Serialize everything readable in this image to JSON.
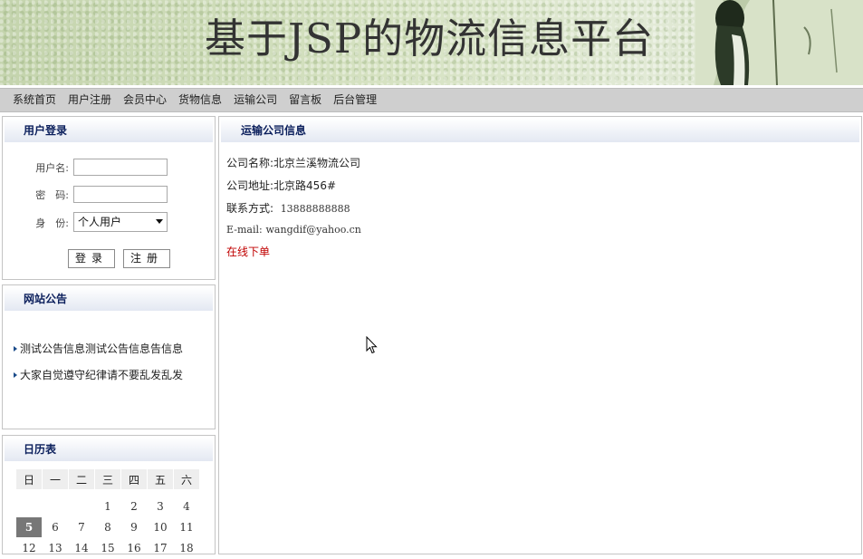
{
  "banner": {
    "title": "基于JSP的物流信息平台"
  },
  "nav": {
    "items": [
      "系统首页",
      "用户注册",
      "会员中心",
      "货物信息",
      "运输公司",
      "留言板",
      "后台管理"
    ]
  },
  "login": {
    "title": "用户登录",
    "username_label": "用户名:",
    "password_label": "密　码:",
    "role_label": "身　份:",
    "role_value": "个人用户",
    "login_button": "登录",
    "register_button": "注册"
  },
  "notice": {
    "title": "网站公告",
    "items": [
      "测试公告信息测试公告信息告信息",
      "大家自觉遵守纪律请不要乱发乱发"
    ]
  },
  "calendar": {
    "title": "日历表",
    "weekdays": [
      "日",
      "一",
      "二",
      "三",
      "四",
      "五",
      "六"
    ],
    "week1": [
      "",
      "",
      "",
      "1",
      "2",
      "3",
      "4"
    ],
    "week2": [
      "5",
      "6",
      "7",
      "8",
      "9",
      "10",
      "11"
    ],
    "week3": [
      "12",
      "13",
      "14",
      "15",
      "16",
      "17",
      "18"
    ],
    "today": "5"
  },
  "company": {
    "title": "运输公司信息",
    "name_label": "公司名称:",
    "name_value": "北京兰溪物流公司",
    "address_label": "公司地址:",
    "address_value": "北京路456#",
    "contact_label": "联系方式:",
    "contact_value": "13888888888",
    "email_label": "E-mail:",
    "email_value": "wangdif@yahoo.cn",
    "order_link": "在线下单"
  },
  "colors": {
    "panel_title": "#0b1f5c",
    "nav_bg": "#cfcfcf",
    "link_red": "#c00000"
  }
}
